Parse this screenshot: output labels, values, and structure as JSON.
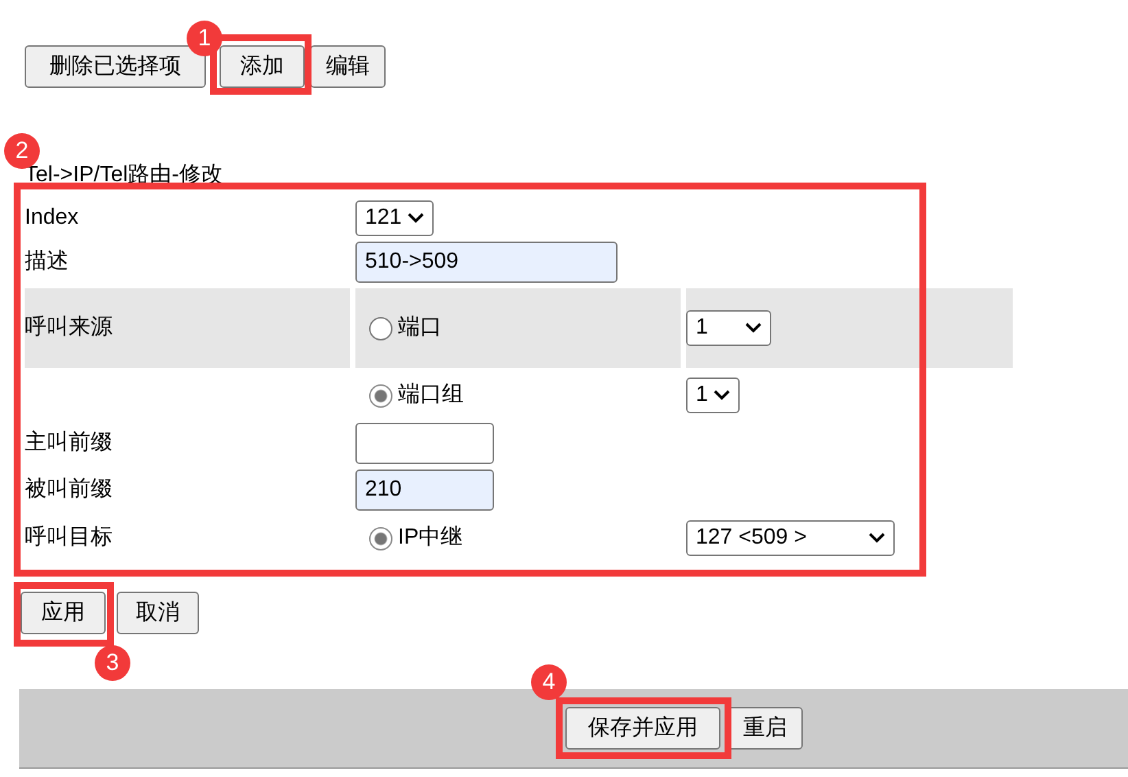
{
  "toolbar": [
    {
      "label": "删除已选择项"
    },
    {
      "label": "添加"
    },
    {
      "label": "编辑"
    }
  ],
  "form": {
    "title": "Tel->IP/Tel路由-修改",
    "rows": [
      {
        "kind": "select",
        "label": "Index",
        "value": "121"
      },
      {
        "kind": "input",
        "label": "描述",
        "value": "510->509",
        "autofilled": true
      },
      {
        "kind": "radio",
        "label": "呼叫来源",
        "option": "端口",
        "selected": false,
        "select": "1",
        "shaded": true
      },
      {
        "kind": "radio",
        "option": "端口组",
        "selected": true,
        "select": "1",
        "shaded": false
      },
      {
        "kind": "input",
        "label": "主叫前缀",
        "autofilled": false
      },
      {
        "kind": "input",
        "label": "被叫前缀",
        "value": "210",
        "autofilled": true
      },
      {
        "kind": "radio",
        "label": "呼叫目标",
        "option": "IP中继",
        "selected": true,
        "select": "127 <509 >",
        "shaded": false
      }
    ]
  },
  "form_buttons": [
    {
      "label": "应用"
    },
    {
      "label": "取消"
    }
  ],
  "footer_buttons": [
    {
      "label": "保存并应用"
    },
    {
      "label": "重启"
    }
  ],
  "annotations": [
    {
      "label": "1"
    },
    {
      "label": "2"
    },
    {
      "label": "3"
    },
    {
      "label": "4"
    }
  ]
}
